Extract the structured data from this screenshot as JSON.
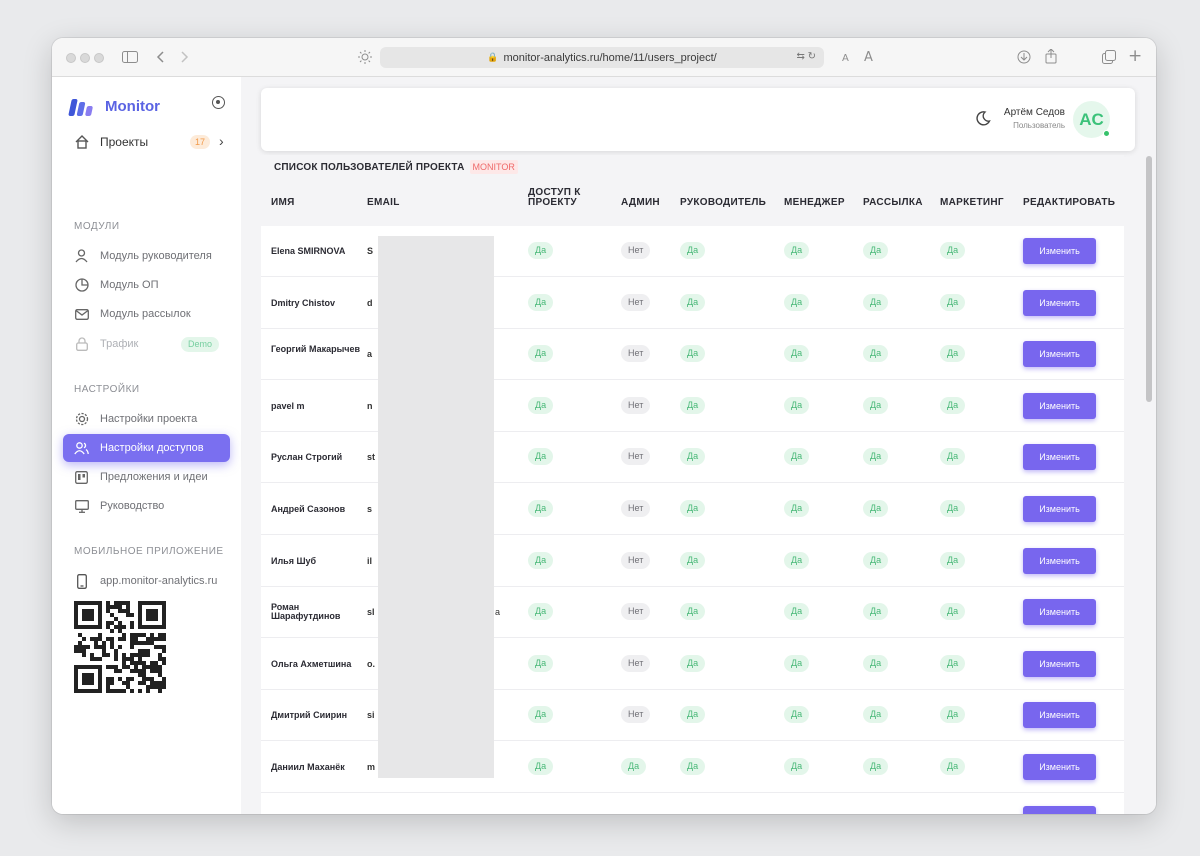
{
  "browser": {
    "url": "monitor-analytics.ru/home/11/users_project/",
    "text_size_small": "A",
    "text_size_large": "A"
  },
  "sidebar": {
    "logo_text": "Monitor",
    "projects": {
      "label": "Проекты",
      "count": "17"
    },
    "sections": {
      "modules": "МОДУЛИ",
      "settings": "НАСТРОЙКИ",
      "mobile": "МОБИЛЬНОЕ ПРИЛОЖЕНИЕ"
    },
    "modules": [
      {
        "label": "Модуль руководителя",
        "icon": "user-icon"
      },
      {
        "label": "Модуль ОП",
        "icon": "pie-chart-icon"
      },
      {
        "label": "Модуль рассылок",
        "icon": "mail-icon"
      },
      {
        "label": "Трафик",
        "icon": "lock-icon",
        "badge": "Demo"
      }
    ],
    "settings_items": [
      {
        "label": "Настройки проекта",
        "icon": "gear-icon"
      },
      {
        "label": "Настройки доступов",
        "icon": "users-icon",
        "active": true
      },
      {
        "label": "Предложения и идеи",
        "icon": "board-icon"
      },
      {
        "label": "Руководство",
        "icon": "monitor-icon"
      }
    ],
    "mobile_link": "app.monitor-analytics.ru"
  },
  "header": {
    "user_name": "Артём Седов",
    "user_role": "Пользователь",
    "avatar_initials": "AC",
    "accent": "#7866ee"
  },
  "table": {
    "title": "СПИСОК ПОЛЬЗОВАТЕЛЕЙ ПРОЕКТА",
    "project_tag": "MONITOR",
    "columns": [
      "ИМЯ",
      "EMAIL",
      "ДОСТУП К ПРОЕКТУ",
      "АДМИН",
      "РУКОВОДИТЕЛЬ",
      "МЕНЕДЖЕР",
      "РАССЫЛКА",
      "МАРКЕТИНГ",
      "РЕДАКТИРОВАТЬ"
    ],
    "yes": "Да",
    "no": "Нет",
    "edit_label": "Изменить",
    "rows": [
      {
        "name": "Elena SMIRNOVA",
        "email": "S",
        "admin": "Нет"
      },
      {
        "name": "Dmitry Chistov",
        "email": "d",
        "admin": "Нет"
      },
      {
        "name": "Георгий Макарычев",
        "email": "a",
        "admin": "Нет"
      },
      {
        "name": "pavel m",
        "email": "n",
        "admin": "Нет"
      },
      {
        "name": "Руслан Строгий",
        "email": "st",
        "admin": "Нет"
      },
      {
        "name": "Андрей Сазонов",
        "email": "s",
        "admin": "Нет"
      },
      {
        "name": "Илья Шуб",
        "email": "il",
        "admin": "Нет"
      },
      {
        "name": "Роман Шарафутдинов",
        "email": "sl",
        "email_tail": "a",
        "admin": "Нет"
      },
      {
        "name": "Ольга Ахметшина",
        "email": "o.",
        "admin": "Нет"
      },
      {
        "name": "Дмитрий Сиирин",
        "email": "si",
        "admin": "Нет"
      },
      {
        "name": "Даниил Маханёк",
        "email": "m",
        "admin": "Да"
      }
    ]
  }
}
